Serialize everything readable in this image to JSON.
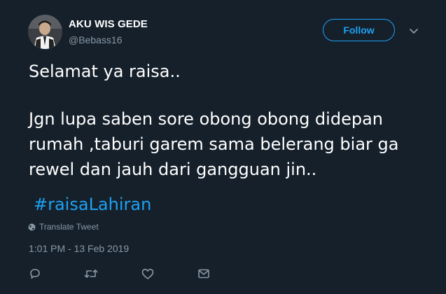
{
  "author": {
    "name": "AKU WIS GEDE",
    "handle": "@Bebass16",
    "avatar": "profile-photo"
  },
  "follow_label": "Follow",
  "tweet": {
    "lines": [
      "Selamat ya raisa..",
      "Jgn lupa saben sore obong obong didepan",
      "rumah ,taburi garem sama belerang biar ga",
      "rewel dan jauh dari gangguan jin.."
    ],
    "hashtag": "#raisaLahiran"
  },
  "translate_label": "Translate Tweet",
  "timestamp": "1:01 PM - 13 Feb 2019",
  "actions": [
    "reply-icon",
    "retweet-icon",
    "like-icon",
    "message-icon"
  ],
  "colors": {
    "background": "#15202b",
    "accent": "#1da1f2",
    "secondary_text": "#8899a6",
    "text": "#ffffff"
  }
}
